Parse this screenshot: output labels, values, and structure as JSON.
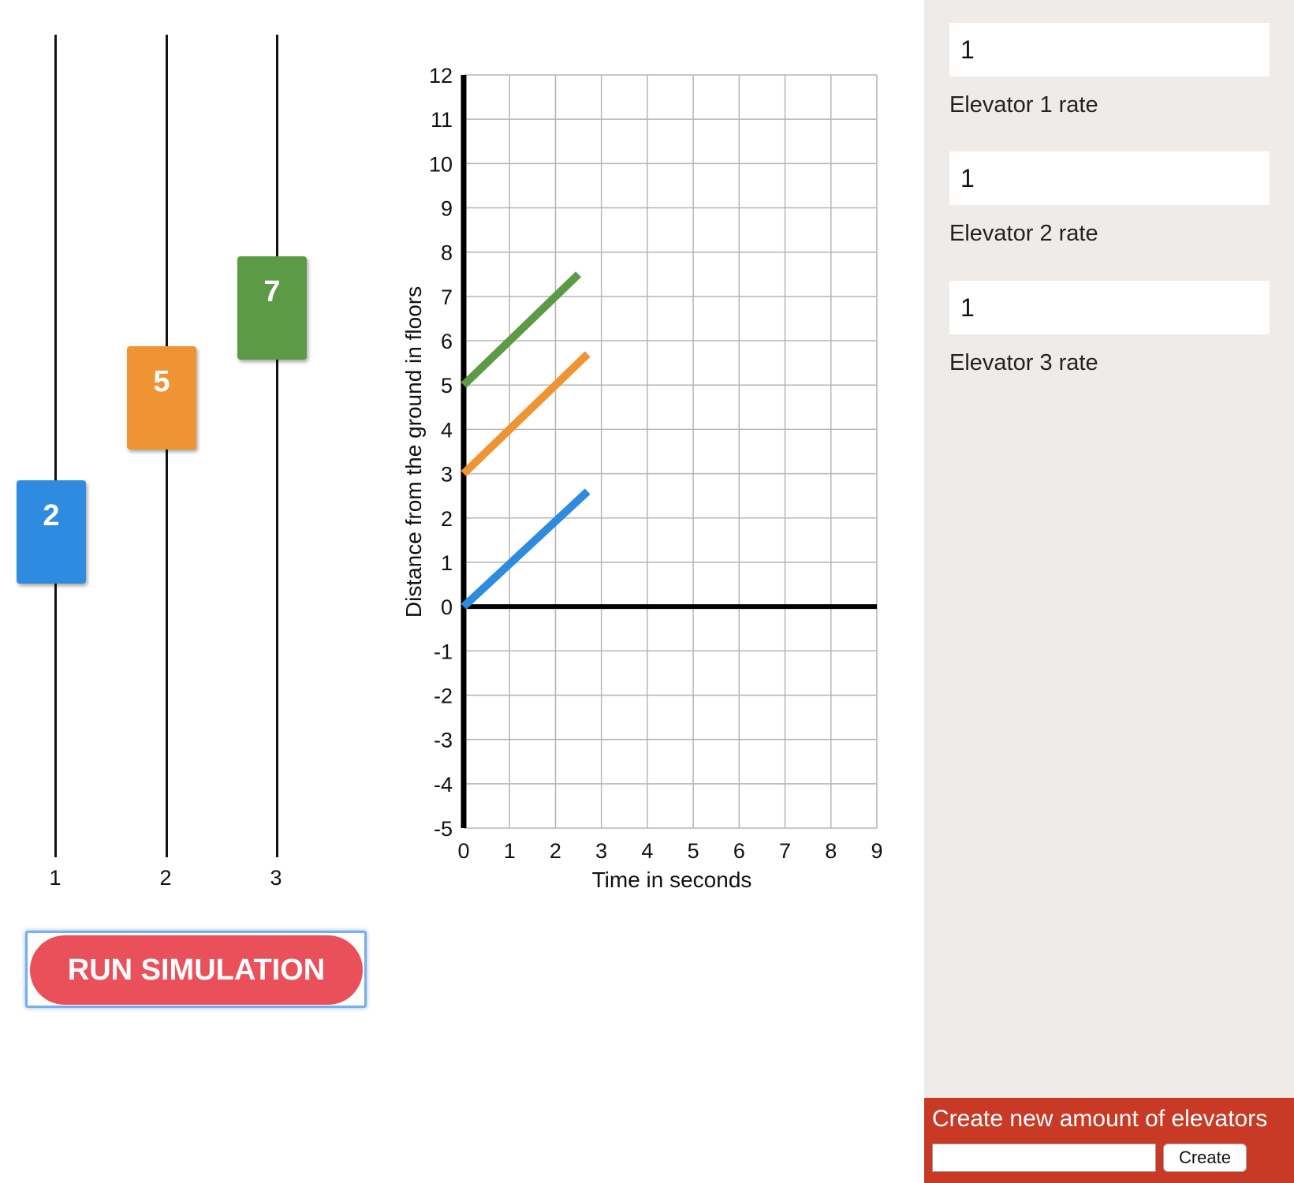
{
  "elevators": [
    {
      "label": "2",
      "track_label": "1",
      "color": "#2f8be0",
      "level": 2
    },
    {
      "label": "5",
      "track_label": "2",
      "color": "#ef9433",
      "level": 5
    },
    {
      "label": "7",
      "track_label": "3",
      "color": "#5c9a46",
      "level": 7
    }
  ],
  "run_button_label": "RUN SIMULATION",
  "sidebar": {
    "rates": [
      {
        "value": "1",
        "label": "Elevator 1 rate"
      },
      {
        "value": "1",
        "label": "Elevator 2 rate"
      },
      {
        "value": "1",
        "label": "Elevator 3 rate"
      }
    ],
    "create_title": "Create new amount of elevators",
    "create_input_value": "",
    "create_button_label": "Create",
    "background_color": "#efebe8",
    "create_panel_color": "#c83a26"
  },
  "chart_data": {
    "type": "line",
    "title": "",
    "xlabel": "Time in seconds",
    "ylabel": "Distance from the ground in floors",
    "xlim": [
      0,
      9
    ],
    "ylim": [
      -5,
      12
    ],
    "x_ticks": [
      "0",
      "1",
      "2",
      "3",
      "4",
      "5",
      "6",
      "7",
      "8",
      "9"
    ],
    "y_ticks": [
      "12",
      "11",
      "10",
      "9",
      "8",
      "7",
      "6",
      "5",
      "4",
      "3",
      "2",
      "1",
      "0",
      "-1",
      "-2",
      "-3",
      "-4",
      "-5"
    ],
    "grid": true,
    "series": [
      {
        "color": "#5c9a46",
        "points": [
          [
            0,
            5
          ],
          [
            2.5,
            7.5
          ]
        ]
      },
      {
        "color": "#ef9433",
        "points": [
          [
            0,
            3
          ],
          [
            2.7,
            5.7
          ]
        ]
      },
      {
        "color": "#2f8be0",
        "points": [
          [
            0,
            0
          ],
          [
            2.7,
            2.6
          ]
        ]
      }
    ]
  }
}
